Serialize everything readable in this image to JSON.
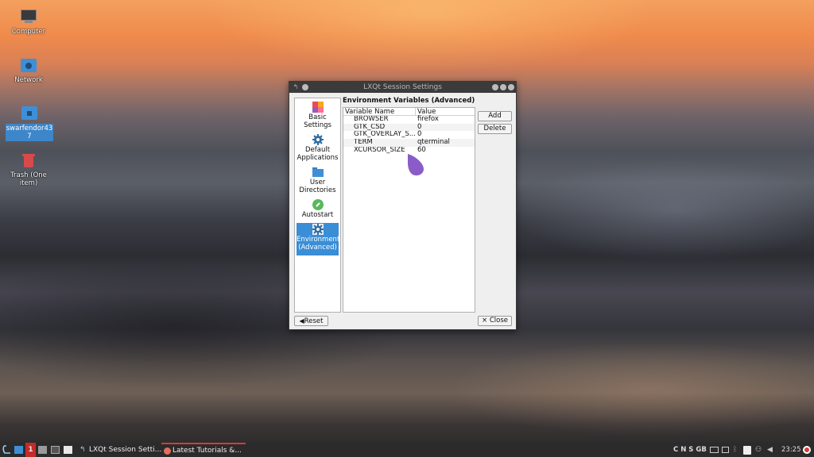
{
  "desktop": {
    "icons": [
      {
        "label": "Computer"
      },
      {
        "label": "Network"
      },
      {
        "label": "swarfendor437"
      },
      {
        "label": "Trash (One item)"
      }
    ]
  },
  "window": {
    "title": "LXQt Session Settings",
    "sidebar": [
      {
        "label": "Basic Settings"
      },
      {
        "label": "Default Applications"
      },
      {
        "label": "User Directories"
      },
      {
        "label": "Autostart"
      },
      {
        "label": "Environment (Advanced)"
      }
    ],
    "heading": "Environment Variables (Advanced)",
    "table": {
      "columns": [
        "Variable Name",
        "Value"
      ],
      "rows": [
        {
          "name": "BROWSER",
          "value": "firefox"
        },
        {
          "name": "GTK_CSD",
          "value": "0"
        },
        {
          "name": "GTK_OVERLAY_S...",
          "value": "0"
        },
        {
          "name": "TERM",
          "value": "qterminal"
        },
        {
          "name": "XCURSOR_SIZE",
          "value": "60"
        }
      ]
    },
    "buttons": {
      "add": "Add",
      "delete": "Delete",
      "reset": "Reset",
      "close": "× Close"
    }
  },
  "taskbar": {
    "workspace": "1",
    "tasks": [
      {
        "label": "LXQt Session Setti..."
      },
      {
        "label": "Latest Tutorials &..."
      }
    ],
    "tray": {
      "keyboard": "C N S GB",
      "clock": "23:25"
    }
  },
  "colors": {
    "accent": "#3a8ed6",
    "cursor": "#8a5cc7",
    "task_underline": "#d83a3a"
  }
}
